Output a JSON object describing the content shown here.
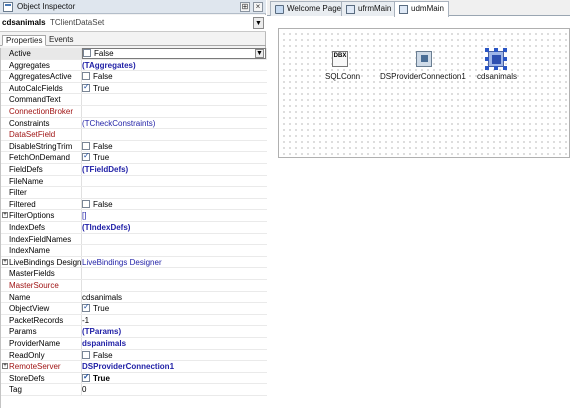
{
  "inspector": {
    "title": "Object Inspector",
    "pin_glyph": "⊞",
    "close_glyph": "×",
    "component_name": "cdsanimals",
    "component_class": "TClientDataSet",
    "tabs": [
      "Properties",
      "Events"
    ],
    "rows": [
      {
        "name": "Active",
        "value": "False",
        "checkbox": "off",
        "selected": true
      },
      {
        "name": "Aggregates",
        "value": "(TAggregates)",
        "value_style": "blue bold"
      },
      {
        "name": "AggregatesActive",
        "value": "False",
        "checkbox": "off"
      },
      {
        "name": "AutoCalcFields",
        "value": "True",
        "checkbox": "on"
      },
      {
        "name": "CommandText",
        "value": ""
      },
      {
        "name": "ConnectionBroker",
        "value": "",
        "name_style": "red"
      },
      {
        "name": "Constraints",
        "value": "(TCheckConstraints)",
        "value_style": "blue"
      },
      {
        "name": "DataSetField",
        "value": "",
        "name_style": "red"
      },
      {
        "name": "DisableStringTrim",
        "value": "False",
        "checkbox": "off"
      },
      {
        "name": "FetchOnDemand",
        "value": "True",
        "checkbox": "on"
      },
      {
        "name": "FieldDefs",
        "value": "(TFieldDefs)",
        "value_style": "blue bold"
      },
      {
        "name": "FileName",
        "value": ""
      },
      {
        "name": "Filter",
        "value": ""
      },
      {
        "name": "Filtered",
        "value": "False",
        "checkbox": "off"
      },
      {
        "name": "FilterOptions",
        "value": "[]",
        "value_style": "blue",
        "expander": true
      },
      {
        "name": "IndexDefs",
        "value": "(TIndexDefs)",
        "value_style": "blue bold"
      },
      {
        "name": "IndexFieldNames",
        "value": ""
      },
      {
        "name": "IndexName",
        "value": ""
      },
      {
        "name": "LiveBindings Designer",
        "value": "LiveBindings Designer",
        "value_style": "blue",
        "expander": true
      },
      {
        "name": "MasterFields",
        "value": ""
      },
      {
        "name": "MasterSource",
        "value": "",
        "name_style": "red"
      },
      {
        "name": "Name",
        "value": "cdsanimals"
      },
      {
        "name": "ObjectView",
        "value": "True",
        "checkbox": "on"
      },
      {
        "name": "PacketRecords",
        "value": "-1"
      },
      {
        "name": "Params",
        "value": "(TParams)",
        "value_style": "blue bold"
      },
      {
        "name": "ProviderName",
        "value": "dspanimals",
        "value_style": "blue bold"
      },
      {
        "name": "ReadOnly",
        "value": "False",
        "checkbox": "off"
      },
      {
        "name": "RemoteServer",
        "value": "DSProviderConnection1",
        "value_style": "blue bold",
        "name_style": "red",
        "expander": true
      },
      {
        "name": "StoreDefs",
        "value": "True",
        "checkbox": "on",
        "value_style": "bold"
      },
      {
        "name": "Tag",
        "value": "0"
      }
    ]
  },
  "designer": {
    "tabs": [
      {
        "label": "Welcome Page",
        "active": false
      },
      {
        "label": "ufrmMain",
        "active": false
      },
      {
        "label": "udmMain",
        "active": true
      }
    ],
    "components": [
      {
        "name": "sqlconn",
        "label": "SQLConn",
        "icon_text": "DBX"
      },
      {
        "name": "dsproviderconnection1",
        "label": "DSProviderConnection1"
      },
      {
        "name": "cdsanimals",
        "label": "cdsanimals",
        "selected": true
      }
    ]
  }
}
